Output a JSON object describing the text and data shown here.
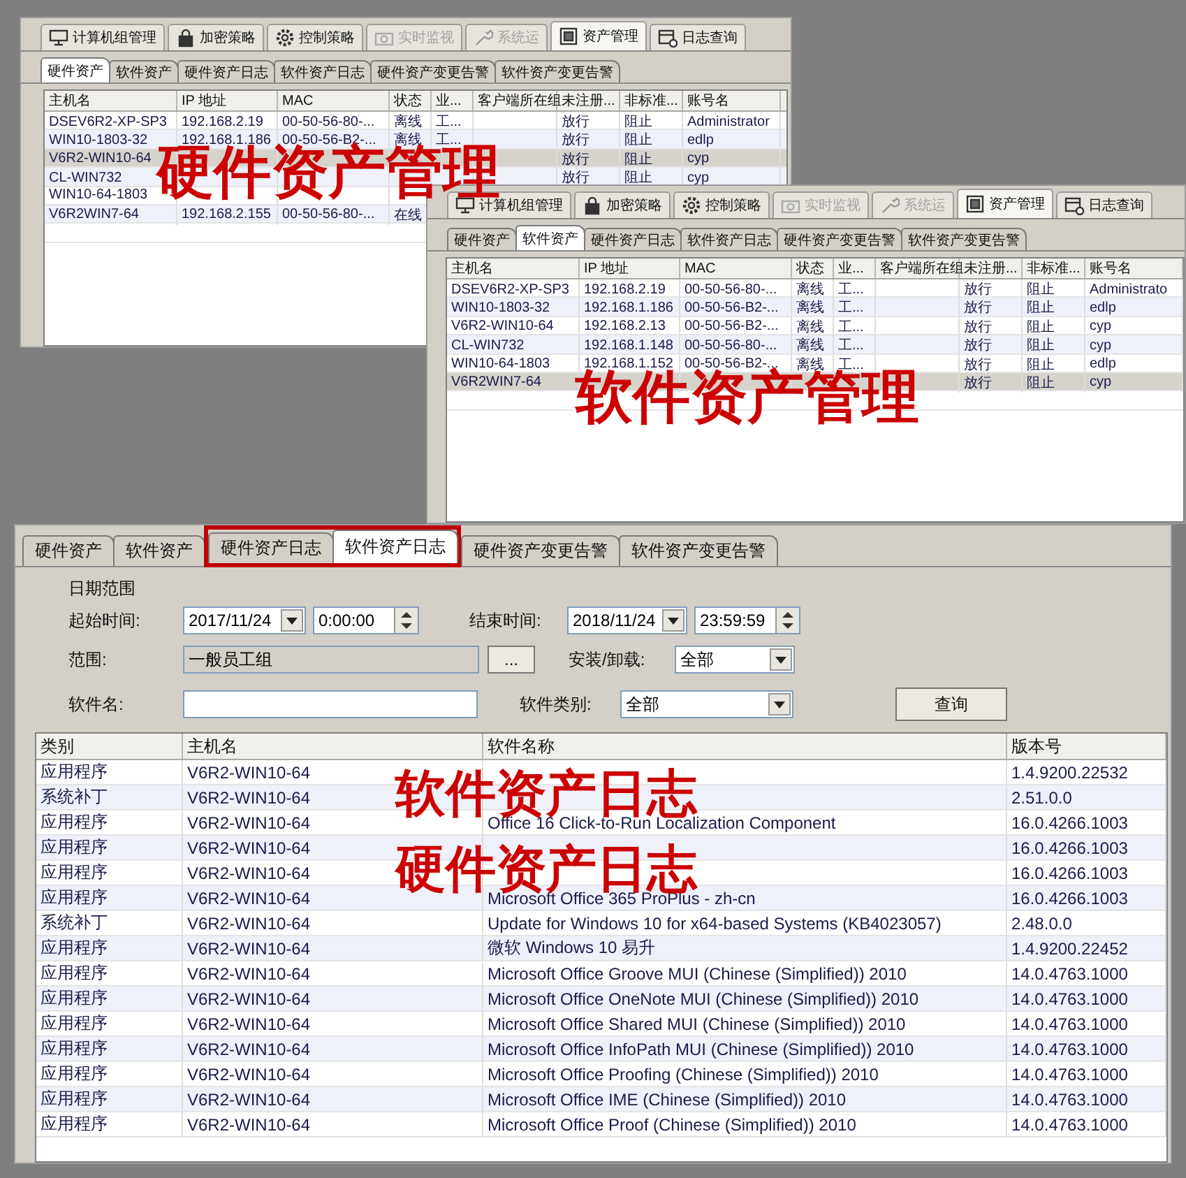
{
  "windows": [
    {
      "main_tabs": [
        {
          "label": "计算机组管理",
          "selected": false,
          "disabled": false
        },
        {
          "label": "加密策略",
          "selected": false,
          "disabled": false
        },
        {
          "label": "控制策略",
          "selected": false,
          "disabled": false
        },
        {
          "label": "实时监视",
          "selected": false,
          "disabled": true
        },
        {
          "label": "系统运",
          "selected": false,
          "disabled": true
        },
        {
          "label": "资产管理",
          "selected": true,
          "disabled": false
        },
        {
          "label": "日志查询",
          "selected": false,
          "disabled": false
        }
      ],
      "sub_tabs": [
        {
          "label": "硬件资产",
          "selected": true
        },
        {
          "label": "软件资产",
          "selected": false
        },
        {
          "label": "硬件资产日志",
          "selected": false
        },
        {
          "label": "软件资产日志",
          "selected": false
        },
        {
          "label": "硬件资产变更告警",
          "selected": false
        },
        {
          "label": "软件资产变更告警",
          "selected": false
        }
      ],
      "table": {
        "columns": [
          "主机名",
          "IP 地址",
          "MAC",
          "状态",
          "业...",
          "客户端所在组",
          "未注册...",
          "非标准...",
          "账号名"
        ],
        "rows": [
          {
            "selected": false,
            "cells": [
              "DSEV6R2-XP-SP3",
              "192.168.2.19",
              "00-50-56-80-...",
              "离线",
              "工...",
              null,
              "放行",
              "阻止",
              "Administrator"
            ]
          },
          {
            "selected": false,
            "cells": [
              "WIN10-1803-32",
              "192.168.1.186",
              "00-50-56-B2-...",
              "离线",
              "工...",
              null,
              "放行",
              "阻止",
              "edlp"
            ]
          },
          {
            "selected": true,
            "cells": [
              "V6R2-WIN10-64",
              null,
              null,
              null,
              null,
              null,
              "放行",
              "阻止",
              "cyp"
            ]
          },
          {
            "selected": false,
            "cells": [
              "CL-WIN732",
              null,
              null,
              null,
              null,
              null,
              "放行",
              "阻止",
              "cyp"
            ]
          },
          {
            "selected": false,
            "cells": [
              "WIN10-64-1803",
              null,
              null,
              null,
              null,
              null,
              null,
              null,
              null
            ]
          },
          {
            "selected": false,
            "cells": [
              "V6R2WIN7-64",
              "192.168.2.155",
              "00-50-56-80-...",
              "在线",
              null,
              null,
              null,
              null,
              null
            ]
          }
        ]
      }
    },
    {
      "main_tabs": [
        {
          "label": "计算机组管理",
          "selected": false,
          "disabled": false
        },
        {
          "label": "加密策略",
          "selected": false,
          "disabled": false
        },
        {
          "label": "控制策略",
          "selected": false,
          "disabled": false
        },
        {
          "label": "实时监视",
          "selected": false,
          "disabled": true
        },
        {
          "label": "系统运",
          "selected": false,
          "disabled": true
        },
        {
          "label": "资产管理",
          "selected": true,
          "disabled": false
        },
        {
          "label": "日志查询",
          "selected": false,
          "disabled": false
        }
      ],
      "sub_tabs": [
        {
          "label": "硬件资产",
          "selected": false
        },
        {
          "label": "软件资产",
          "selected": true
        },
        {
          "label": "硬件资产日志",
          "selected": false
        },
        {
          "label": "软件资产日志",
          "selected": false
        },
        {
          "label": "硬件资产变更告警",
          "selected": false
        },
        {
          "label": "软件资产变更告警",
          "selected": false
        }
      ],
      "table": {
        "columns": [
          "主机名",
          "IP 地址",
          "MAC",
          "状态",
          "业...",
          "客户端所在组",
          "未注册...",
          "非标准...",
          "账号名"
        ],
        "rows": [
          {
            "selected": false,
            "cells": [
              "DSEV6R2-XP-SP3",
              "192.168.2.19",
              "00-50-56-80-...",
              "离线",
              "工...",
              null,
              "放行",
              "阻止",
              "Administrato"
            ]
          },
          {
            "selected": false,
            "cells": [
              "WIN10-1803-32",
              "192.168.1.186",
              "00-50-56-B2-...",
              "离线",
              "工...",
              null,
              "放行",
              "阻止",
              "edlp"
            ]
          },
          {
            "selected": false,
            "cells": [
              "V6R2-WIN10-64",
              "192.168.2.13",
              "00-50-56-B2-...",
              "离线",
              "工...",
              null,
              "放行",
              "阻止",
              "cyp"
            ]
          },
          {
            "selected": false,
            "cells": [
              "CL-WIN732",
              "192.168.1.148",
              "00-50-56-80-...",
              "离线",
              "工...",
              null,
              "放行",
              "阻止",
              "cyp"
            ]
          },
          {
            "selected": false,
            "cells": [
              "WIN10-64-1803",
              "192.168.1.152",
              "00-50-56-B2-...",
              "离线",
              "工...",
              null,
              "放行",
              "阻止",
              "edlp"
            ]
          },
          {
            "selected": true,
            "cells": [
              "V6R2WIN7-64",
              null,
              null,
              null,
              null,
              null,
              "放行",
              "阻止",
              "cyp"
            ]
          }
        ]
      }
    }
  ],
  "log_window": {
    "sub_tabs": [
      {
        "label": "硬件资产",
        "selected": false
      },
      {
        "label": "软件资产",
        "selected": false
      },
      {
        "label": "硬件资产日志",
        "selected": false
      },
      {
        "label": "软件资产日志",
        "selected": true
      },
      {
        "label": "硬件资产变更告警",
        "selected": false
      },
      {
        "label": "软件资产变更告警",
        "selected": false
      }
    ],
    "filters": {
      "date_range_label": "日期范围",
      "start_label": "起始时间:",
      "start_date": "2017/11/24",
      "start_time": "0:00:00",
      "end_label": "结束时间:",
      "end_date": "2018/11/24",
      "end_time": "23:59:59",
      "scope_label": "范围:",
      "scope_value": "一般员工组",
      "browse_button": "...",
      "install_label": "安装/卸载:",
      "install_value": "全部",
      "name_label": "软件名:",
      "category_label": "软件类别:",
      "category_value": "全部",
      "query_button": "查询"
    },
    "table": {
      "columns": [
        "类别",
        "主机名",
        "软件名称",
        "版本号"
      ],
      "rows": [
        {
          "selected": false,
          "cells": [
            "应用程序",
            "V6R2-WIN10-64",
            null,
            "1.4.9200.22532"
          ]
        },
        {
          "selected": false,
          "cells": [
            "系统补丁",
            "V6R2-WIN10-64",
            null,
            "2.51.0.0"
          ]
        },
        {
          "selected": false,
          "cells": [
            "应用程序",
            "V6R2-WIN10-64",
            "Office 16 Click-to-Run Localization Component",
            "16.0.4266.1003"
          ]
        },
        {
          "selected": false,
          "cells": [
            "应用程序",
            "V6R2-WIN10-64",
            null,
            "16.0.4266.1003"
          ]
        },
        {
          "selected": false,
          "cells": [
            "应用程序",
            "V6R2-WIN10-64",
            null,
            "16.0.4266.1003"
          ]
        },
        {
          "selected": false,
          "cells": [
            "应用程序",
            "V6R2-WIN10-64",
            "Microsoft Office 365 ProPlus - zh-cn",
            "16.0.4266.1003"
          ]
        },
        {
          "selected": false,
          "cells": [
            "系统补丁",
            "V6R2-WIN10-64",
            "Update for Windows 10 for x64-based Systems (KB4023057)",
            "2.48.0.0"
          ]
        },
        {
          "selected": false,
          "cells": [
            "应用程序",
            "V6R2-WIN10-64",
            "微软 Windows 10 易升",
            "1.4.9200.22452"
          ]
        },
        {
          "selected": false,
          "cells": [
            "应用程序",
            "V6R2-WIN10-64",
            "Microsoft Office Groove MUI (Chinese (Simplified)) 2010",
            "14.0.4763.1000"
          ]
        },
        {
          "selected": false,
          "cells": [
            "应用程序",
            "V6R2-WIN10-64",
            "Microsoft Office OneNote MUI (Chinese (Simplified)) 2010",
            "14.0.4763.1000"
          ]
        },
        {
          "selected": false,
          "cells": [
            "应用程序",
            "V6R2-WIN10-64",
            "Microsoft Office Shared MUI (Chinese (Simplified)) 2010",
            "14.0.4763.1000"
          ]
        },
        {
          "selected": false,
          "cells": [
            "应用程序",
            "V6R2-WIN10-64",
            "Microsoft Office InfoPath MUI (Chinese (Simplified)) 2010",
            "14.0.4763.1000"
          ]
        },
        {
          "selected": false,
          "cells": [
            "应用程序",
            "V6R2-WIN10-64",
            "Microsoft Office Proofing (Chinese (Simplified)) 2010",
            "14.0.4763.1000"
          ]
        },
        {
          "selected": false,
          "cells": [
            "应用程序",
            "V6R2-WIN10-64",
            "Microsoft Office IME (Chinese (Simplified)) 2010",
            "14.0.4763.1000"
          ]
        },
        {
          "selected": false,
          "cells": [
            "应用程序",
            "V6R2-WIN10-64",
            "Microsoft Office Proof (Chinese (Simplified)) 2010",
            "14.0.4763.1000"
          ]
        }
      ]
    }
  },
  "captions": [
    "硬件资产管理",
    "软件资产管理",
    "软件资产日志",
    "硬件资产日志"
  ]
}
